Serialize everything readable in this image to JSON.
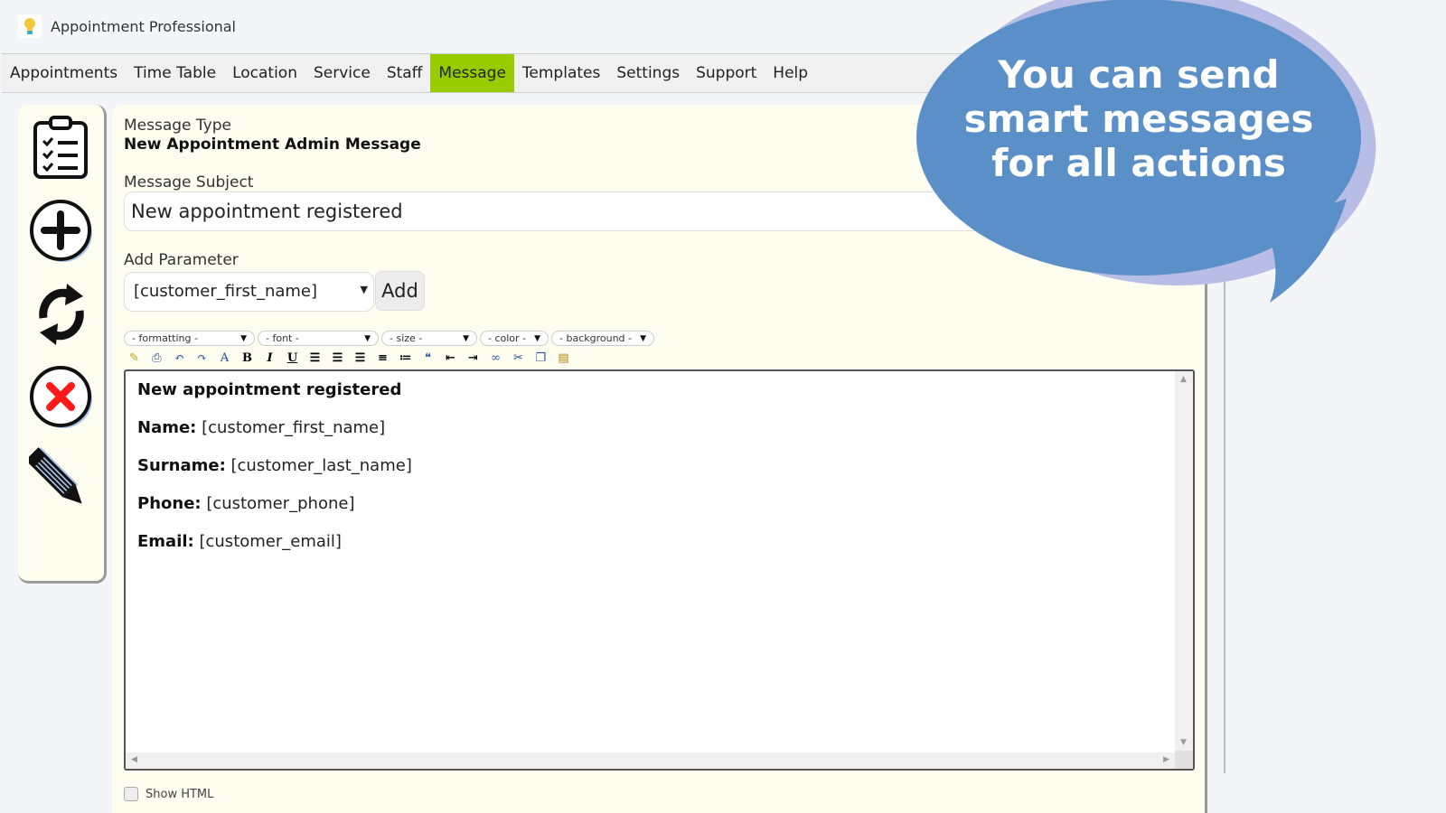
{
  "app": {
    "title": "Appointment Professional",
    "icon": "lightbulb-icon"
  },
  "menu": {
    "items": [
      {
        "label": "Appointments",
        "active": false
      },
      {
        "label": "Time Table",
        "active": false
      },
      {
        "label": "Location",
        "active": false
      },
      {
        "label": "Service",
        "active": false
      },
      {
        "label": "Staff",
        "active": false
      },
      {
        "label": "Message",
        "active": true
      },
      {
        "label": "Templates",
        "active": false
      },
      {
        "label": "Settings",
        "active": false
      },
      {
        "label": "Support",
        "active": false
      },
      {
        "label": "Help",
        "active": false
      }
    ],
    "active_color": "#99cc00"
  },
  "sidebar": {
    "buttons": [
      {
        "icon": "clipboard-list-icon",
        "action": "list"
      },
      {
        "icon": "add-circle-icon",
        "action": "add"
      },
      {
        "icon": "refresh-icon",
        "action": "refresh"
      },
      {
        "icon": "delete-icon",
        "action": "delete"
      },
      {
        "icon": "pencil-icon",
        "action": "edit"
      }
    ]
  },
  "form": {
    "message_type_label": "Message Type",
    "message_type_value": "New Appointment Admin Message",
    "subject_label": "Message Subject",
    "subject_value": "New appointment registered",
    "add_parameter_label": "Add Parameter",
    "parameter_selected": "[customer_first_name]",
    "add_button": "Add"
  },
  "editor": {
    "dropdowns": [
      "- formatting -",
      "- font -",
      "- size -",
      "- color -",
      "- background -"
    ],
    "toolbar": [
      "clean-icon",
      "print-icon",
      "undo-icon",
      "redo-icon",
      "remove-format-icon",
      "bold-icon",
      "italic-icon",
      "underline-icon",
      "align-left-icon",
      "align-center-icon",
      "align-right-icon",
      "ordered-list-icon",
      "unordered-list-icon",
      "quote-icon",
      "outdent-icon",
      "indent-icon",
      "link-icon",
      "cut-icon",
      "copy-icon",
      "paste-icon"
    ],
    "heading": "New appointment registered",
    "fields": [
      {
        "label": "Name:",
        "value": "[customer_first_name]"
      },
      {
        "label": "Surname:",
        "value": "[customer_last_name]"
      },
      {
        "label": "Phone:",
        "value": "[customer_phone]"
      },
      {
        "label": "Email:",
        "value": "[customer_email]"
      }
    ],
    "show_html_label": "Show HTML"
  },
  "callout": {
    "lines": [
      "You can send",
      "smart messages",
      "for all actions"
    ],
    "color": "#5a8fc8",
    "shadow_color": "#b8bde6"
  }
}
